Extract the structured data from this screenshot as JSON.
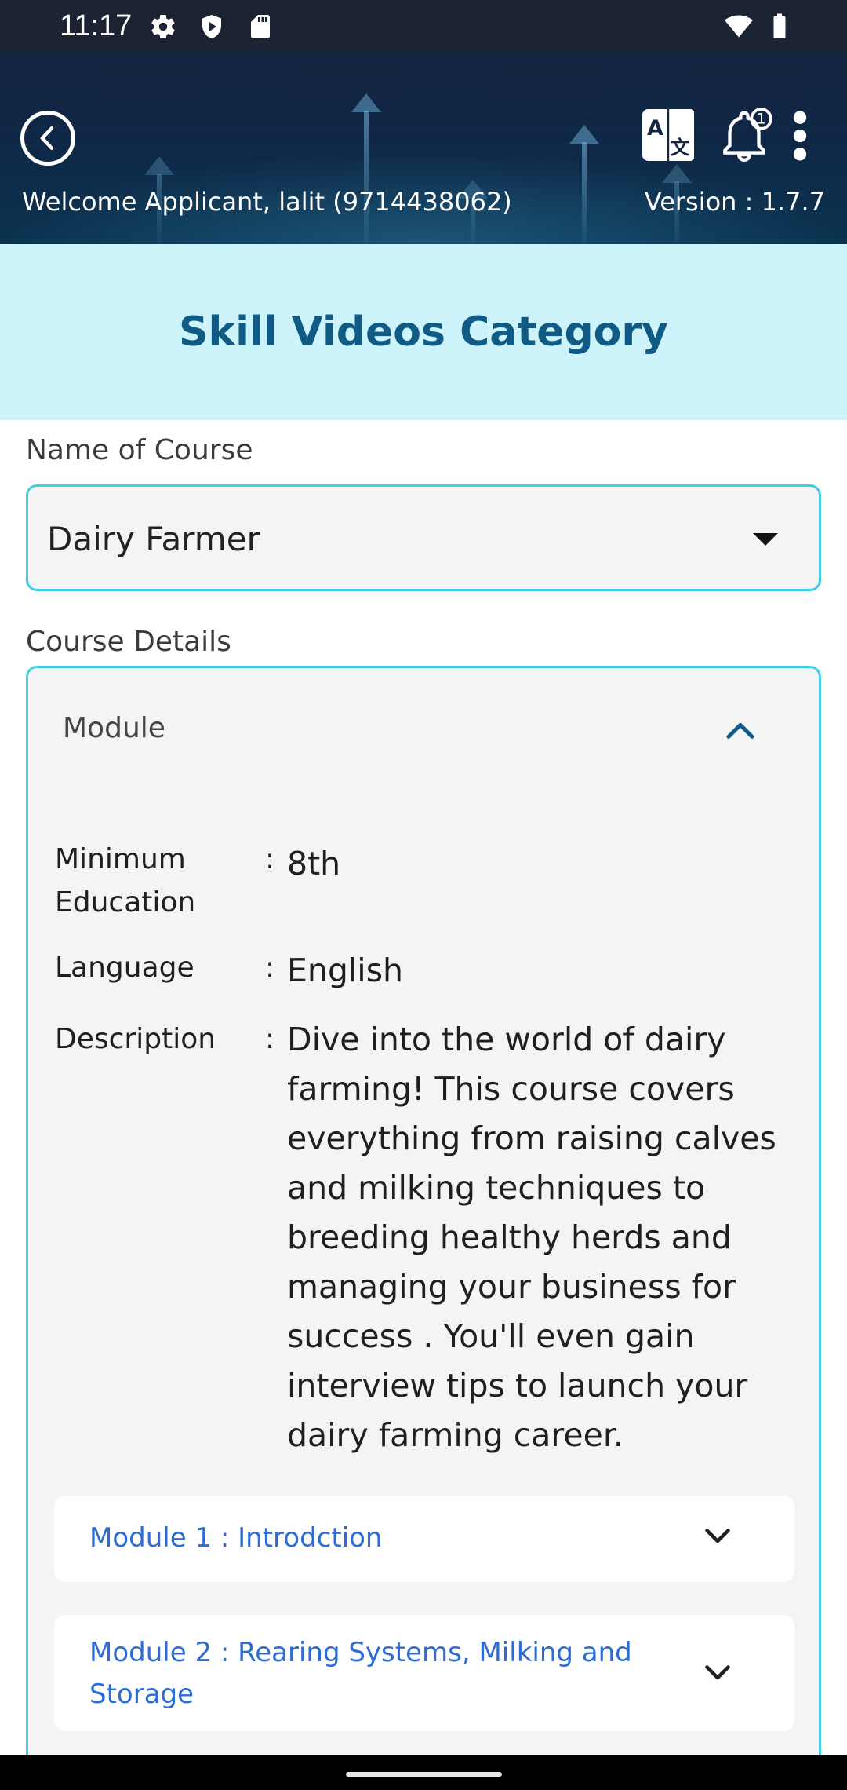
{
  "status_bar": {
    "time": "11:17",
    "icons": [
      "gear-icon",
      "shield-play-icon",
      "sd-card-icon",
      "wifi-icon",
      "battery-icon"
    ]
  },
  "header": {
    "welcome": "Welcome Applicant, lalit (9714438062)",
    "version": "Version : 1.7.7",
    "notification_count": "1",
    "icons": [
      "back-arrow-icon",
      "translate-icon",
      "bell-icon",
      "more-vert-icon"
    ]
  },
  "page": {
    "title": "Skill Videos Category"
  },
  "form": {
    "course_label": "Name of Course",
    "course_value": "Dairy Farmer",
    "details_label": "Course Details",
    "module_header": "Module",
    "rows": [
      {
        "label_line1": "Minimum",
        "label_line2": "Education",
        "value": "8th"
      },
      {
        "label": "Language",
        "value": "English"
      },
      {
        "label": "Description",
        "value": "Dive into the world of dairy farming! This course covers everything from raising calves and milking techniques to breeding healthy herds and managing your business for success . You'll even gain interview tips to launch your dairy farming career."
      }
    ],
    "colon": ":",
    "modules": [
      {
        "label": "Module 1 : Introdction"
      },
      {
        "label_line1": "Module 2 : Rearing Systems, Milking and",
        "label_line2": "Storage"
      }
    ]
  },
  "colors": {
    "accent": "#3fd0e8",
    "title": "#0f5b85",
    "module_link": "#2b6cd6",
    "title_band": "#cdf3fb"
  }
}
